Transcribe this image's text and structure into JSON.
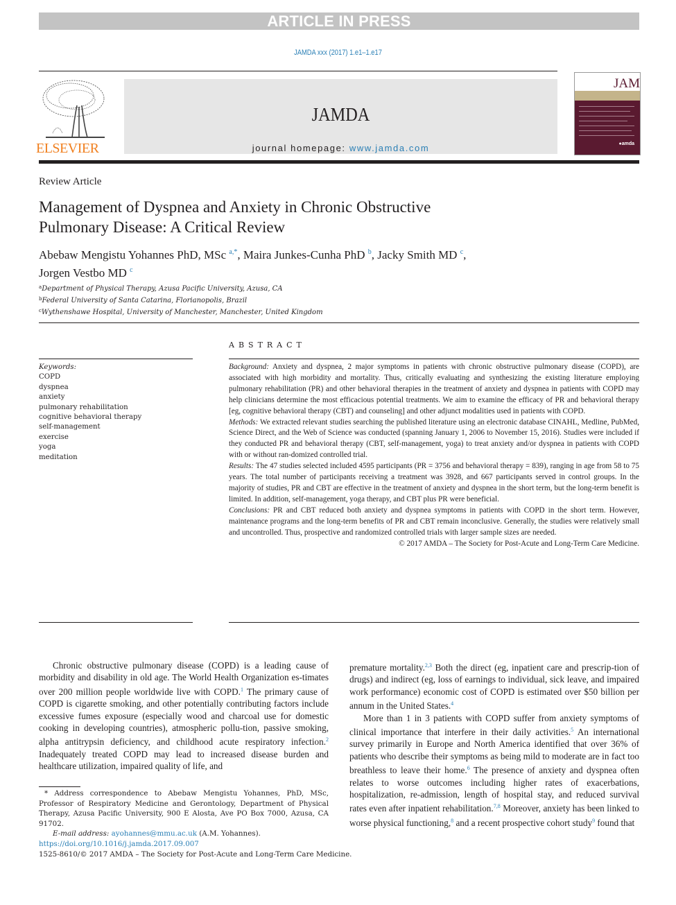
{
  "banner": {
    "text": "ARTICLE IN PRESS"
  },
  "citation": "JAMDA xxx (2017) 1.e1–1.e17",
  "header": {
    "publisher": "ELSEVIER",
    "journal": "JAMDA",
    "homepage_label": "journal homepage: ",
    "homepage_url": "www.jamda.com",
    "cover_title": "JAMDA",
    "cover_logo": "●amda"
  },
  "article": {
    "section": "Review Article",
    "title_line1": "Management of Dyspnea and Anxiety in Chronic Obstructive",
    "title_line2": "Pulmonary Disease: A Critical Review",
    "authors": [
      {
        "name": "Abebaw Mengistu Yohannes PhD, MSc",
        "sup": "a,*",
        "sep": ", "
      },
      {
        "name": "Maira Junkes-Cunha PhD",
        "sup": "b",
        "sep": ", "
      },
      {
        "name": "Jacky Smith MD",
        "sup": "c",
        "sep": ","
      },
      {
        "name": "Jorgen Vestbo MD",
        "sup": "c",
        "sep": ""
      }
    ],
    "affiliations": [
      {
        "sup": "a",
        "text": "Department of Physical Therapy, Azusa Pacific University, Azusa, CA"
      },
      {
        "sup": "b",
        "text": "Federal University of Santa Catarina, Florianopolis, Brazil"
      },
      {
        "sup": "c",
        "text": "Wythenshawe Hospital, University of Manchester, Manchester, United Kingdom"
      }
    ]
  },
  "keywords": {
    "label": "Keywords:",
    "items": [
      "COPD",
      "dyspnea",
      "anxiety",
      "pulmonary rehabilitation",
      "cognitive behavioral therapy",
      "self-management",
      "exercise",
      "yoga",
      "meditation"
    ]
  },
  "abstract": {
    "heading": "ABSTRACT",
    "sections": [
      {
        "label": "Background:",
        "text": " Anxiety and dyspnea, 2 major symptoms in patients with chronic obstructive pulmonary disease (COPD), are associated with high morbidity and mortality. Thus, critically evaluating and synthesizing the existing literature employing pulmonary rehabilitation (PR) and other behavioral therapies in the treatment of anxiety and dyspnea in patients with COPD may help clinicians determine the most efficacious potential treatments. We aim to examine the efficacy of PR and behavioral therapy [eg, cognitive behavioral therapy (CBT) and counseling] and other adjunct modalities used in patients with COPD."
      },
      {
        "label": "Methods:",
        "text": " We extracted relevant studies searching the published literature using an electronic database CINAHL, Medline, PubMed, Science Direct, and the Web of Science was conducted (spanning January 1, 2006 to November 15, 2016). Studies were included if they conducted PR and behavioral therapy (CBT, self-management, yoga) to treat anxiety and/or dyspnea in patients with COPD with or without ran-domized controlled trial."
      },
      {
        "label": "Results:",
        "text": " The 47 studies selected included 4595 participants (PR = 3756 and behavioral therapy = 839), ranging in age from 58 to 75 years. The total number of participants receiving a treatment was 3928, and 667 participants served in control groups. In the majority of studies, PR and CBT are effective in the treatment of anxiety and dyspnea in the short term, but the long-term benefit is limited. In addition, self-management, yoga therapy, and CBT plus PR were beneficial."
      },
      {
        "label": "Conclusions:",
        "text": " PR and CBT reduced both anxiety and dyspnea symptoms in patients with COPD in the short term. However, maintenance programs and the long-term benefits of PR and CBT remain inconclusive. Generally, the studies were relatively small and uncontrolled. Thus, prospective and randomized controlled trials with larger sample sizes are needed."
      }
    ],
    "copyright": "© 2017 AMDA – The Society for Post-Acute and Long-Term Care Medicine."
  },
  "body": {
    "left": {
      "p1": [
        "Chronic obstructive pulmonary disease (COPD) is a leading cause of morbidity and disability in old age. The World Health Organization es-timates over 200 million people worldwide live with COPD.",
        "1",
        " The primary cause of COPD is cigarette smoking, and other potentially contributing factors include excessive fumes exposure (especially wood and charcoal use for domestic cooking in developing countries), atmospheric pollu-tion, passive smoking, alpha antitrypsin deficiency, and childhood acute respiratory infection.",
        "2",
        " Inadequately treated COPD may lead to increased disease burden and healthcare utilization, impaired quality of life, and"
      ]
    },
    "right": {
      "p1": [
        "premature mortality.",
        "2,3",
        " Both the direct (eg, inpatient care and prescrip-tion of drugs) and indirect (eg, loss of earnings to individual, sick leave, and impaired work performance) economic cost of COPD is estimated over $50 billion per annum in the United States.",
        "4"
      ],
      "p2": [
        "More than 1 in 3 patients with COPD suffer from anxiety symptoms of clinical importance that interfere in their daily activities.",
        "5",
        " An international survey primarily in Europe and North America identified that over 36% of patients who describe their symptoms as being mild to moderate are in fact too breathless to leave their home.",
        "6",
        " The presence of anxiety and dyspnea often relates to worse outcomes including higher rates of exacerbations, hospitalization, re-admission, length of hospital stay, and reduced survival rates even after inpatient rehabilitation.",
        "7,8",
        " Moreover, anxiety has been linked to worse physical functioning,",
        "8",
        " and a recent prospective cohort study",
        "9",
        " found that"
      ]
    }
  },
  "footnote": {
    "correspondence": "* Address correspondence to Abebaw Mengistu Yohannes, PhD, MSc, Professor of Respiratory Medicine and Gerontology, Department of Physical Therapy, Azusa Pacific University, 900 E Alosta, Ave PO Box 7000, Azusa, CA 91702.",
    "email_label": "E-mail address:",
    "email": "ayohannes@mmu.ac.uk",
    "email_suffix": " (A.M. Yohannes)."
  },
  "doi": {
    "url": "https://doi.org/10.1016/j.jamda.2017.09.007",
    "issn_line": "1525-8610/© 2017 AMDA – The Society for Post-Acute and Long-Term Care Medicine."
  }
}
